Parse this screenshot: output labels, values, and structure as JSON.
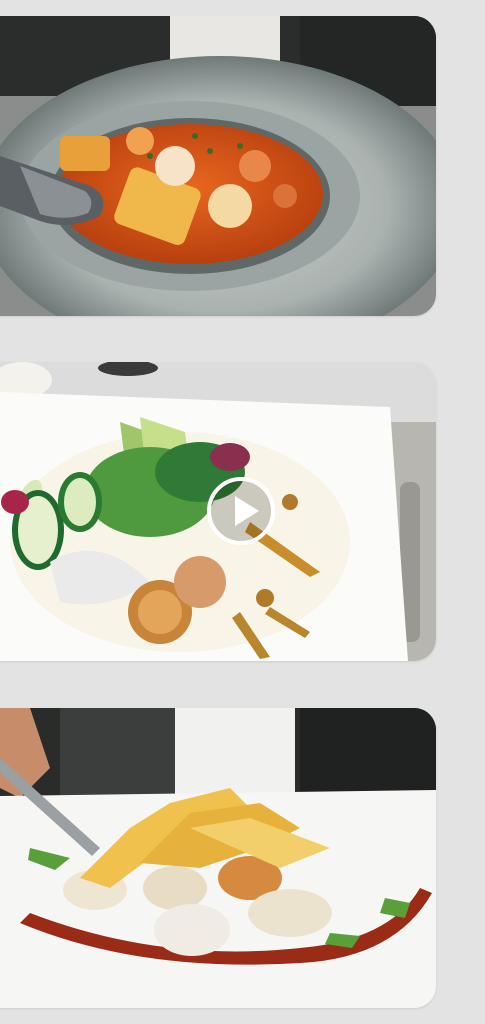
{
  "feed": {
    "background_color": "#e3e3e3",
    "items": [
      {
        "type": "photo",
        "content": "seafood-soup-bowl-photo"
      },
      {
        "type": "video",
        "content": "salad-plate-video",
        "overlay_icon": "play-icon"
      },
      {
        "type": "photo",
        "content": "scallop-plate-photo"
      }
    ]
  }
}
